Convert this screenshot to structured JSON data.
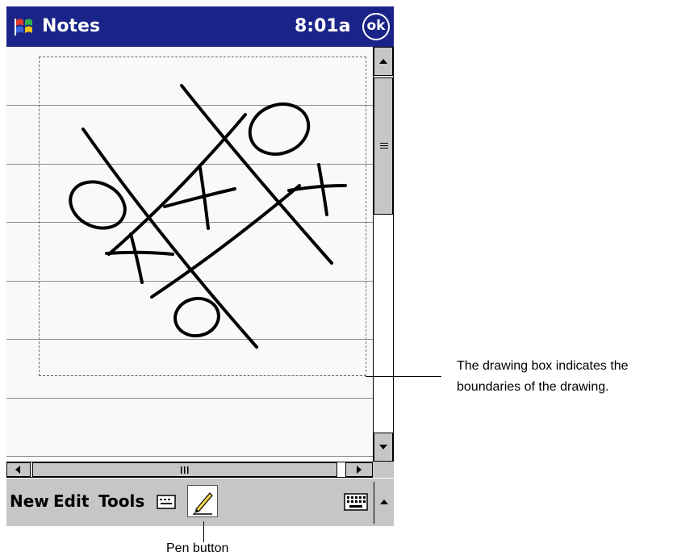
{
  "window": {
    "app_title": "Notes",
    "clock": "8:01a",
    "ok_label": "ok",
    "app_icon": "windows-flag-icon",
    "title_bar_color": "#1a2488"
  },
  "note": {
    "background_color": "#f7faf7",
    "drawing_content": "tic-tac-toe sketch"
  },
  "vertical_scrollbar": {
    "up_icon": "arrow-up-icon",
    "down_icon": "arrow-down-icon",
    "thumb_grip_icon": "grip-icon"
  },
  "horizontal_scrollbar": {
    "left_icon": "arrow-left-icon",
    "right_icon": "arrow-right-icon",
    "thumb_grip_icon": "grip-icon"
  },
  "command_bar": {
    "menus": [
      "New",
      "Edit",
      "Tools"
    ],
    "recording_icon": "recording-toolbar-icon",
    "pen_icon": "pen-icon",
    "keyboard_icon": "keyboard-icon",
    "sip_arrow_icon": "arrow-up-icon"
  },
  "callouts": {
    "drawing_box": "The drawing box indicates the boundaries of the drawing.",
    "pen_button": "Pen button"
  }
}
